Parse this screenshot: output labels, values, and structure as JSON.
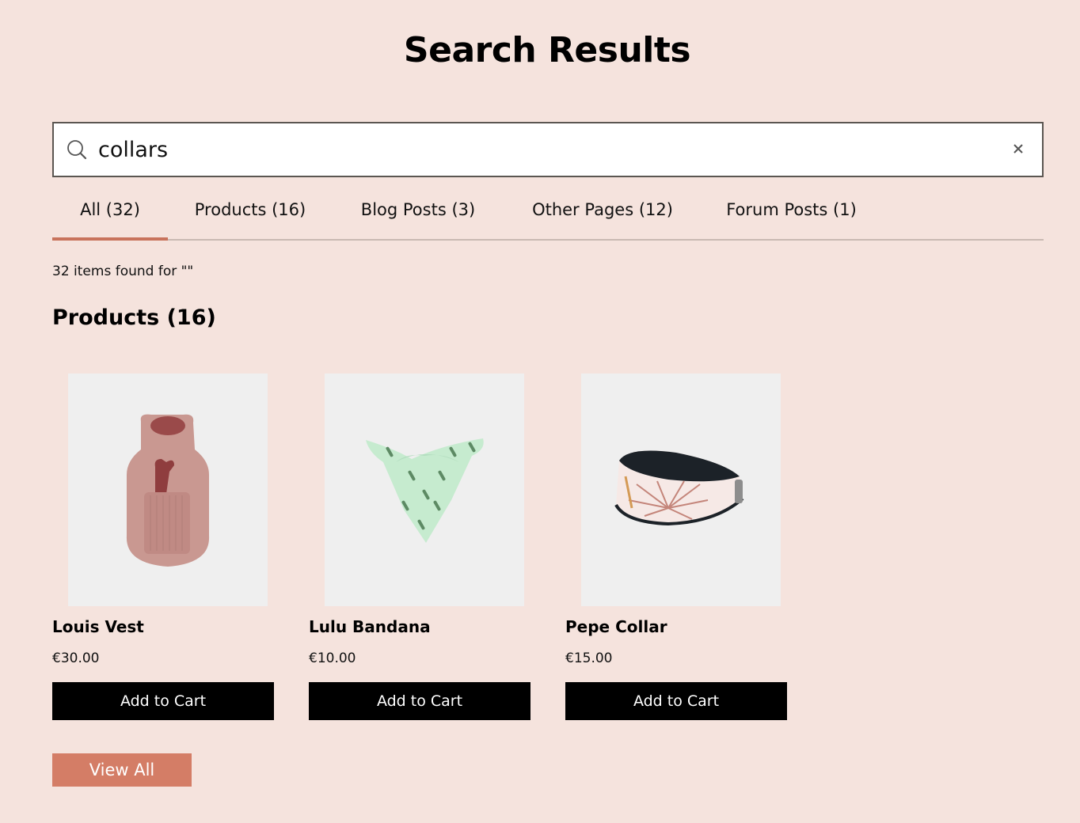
{
  "page": {
    "title": "Search Results"
  },
  "search": {
    "value": "collars",
    "placeholder": "",
    "icon": "search-icon",
    "clear_icon": "close-icon"
  },
  "tabs": [
    {
      "label": "All (32)",
      "active": true
    },
    {
      "label": "Products (16)",
      "active": false
    },
    {
      "label": "Blog Posts (3)",
      "active": false
    },
    {
      "label": "Other Pages (12)",
      "active": false
    },
    {
      "label": "Forum Posts (1)",
      "active": false
    }
  ],
  "results": {
    "summary": "32 items found for \"\"",
    "section_title": "Products (16)",
    "products": [
      {
        "name": "Louis Vest",
        "price": "€30.00",
        "button": "Add to Cart",
        "image": "pink knit dog vest with bone pocket"
      },
      {
        "name": "Lulu Bandana",
        "price": "€10.00",
        "button": "Add to Cart",
        "image": "mint green cactus-print bandana"
      },
      {
        "name": "Pepe Collar",
        "price": "€15.00",
        "button": "Add to Cart",
        "image": "black leather collar with tropical leaf print"
      }
    ],
    "view_all_label": "View All"
  },
  "colors": {
    "background": "#f5e3dd",
    "accent": "#c8735c",
    "view_all": "#d47d66",
    "button": "#000000"
  }
}
